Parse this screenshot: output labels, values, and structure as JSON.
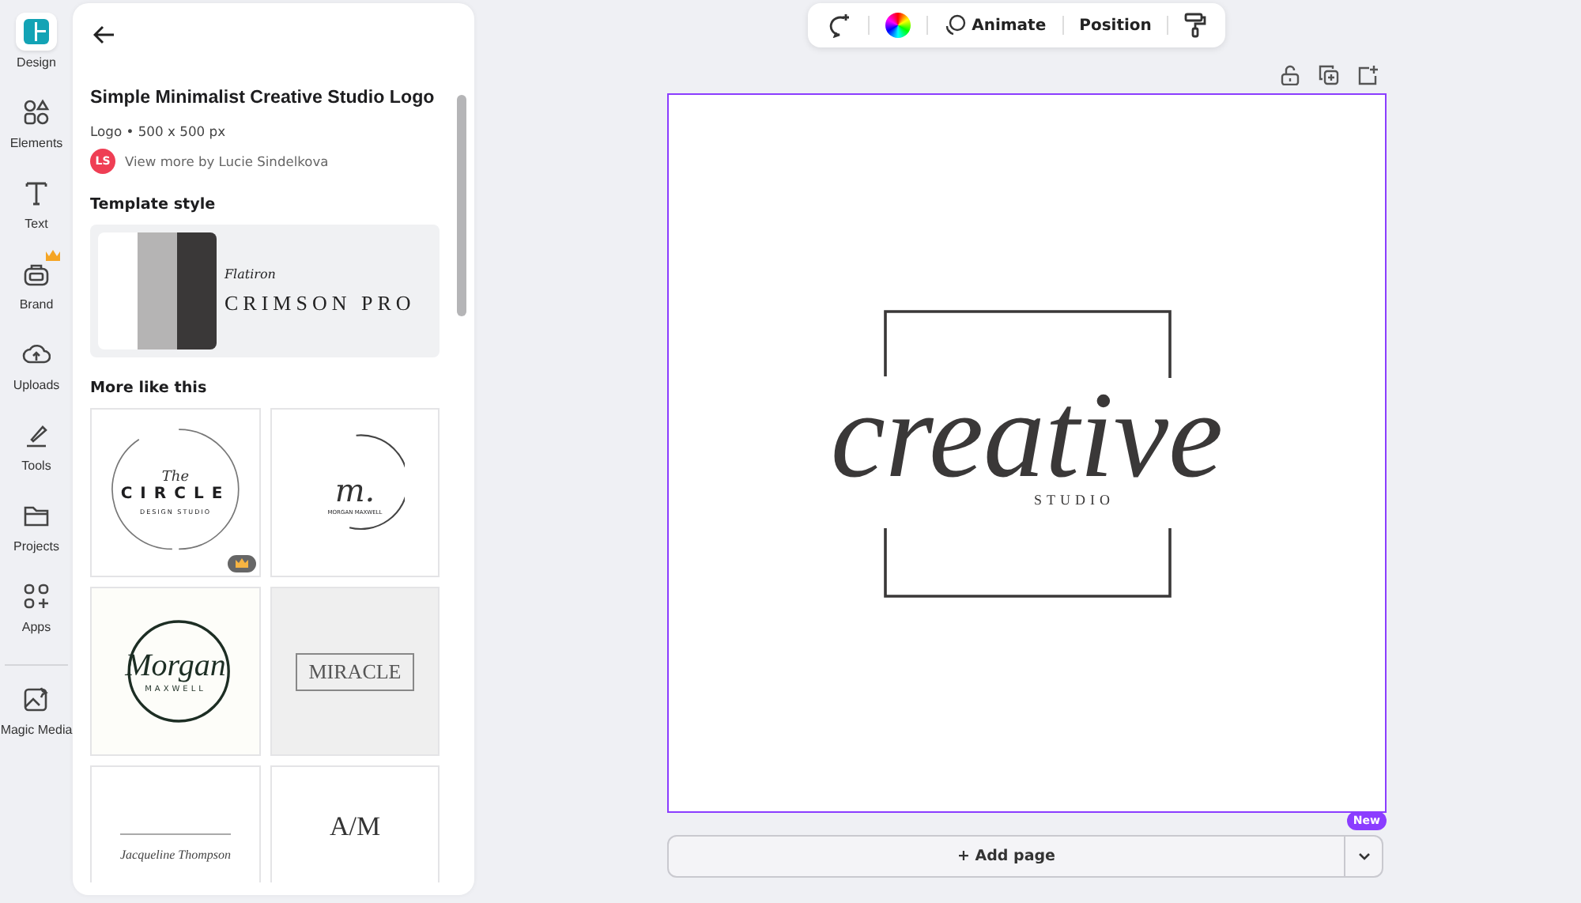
{
  "rail": {
    "items": [
      {
        "label": "Design",
        "kind": "design",
        "selected": true,
        "premium": false
      },
      {
        "label": "Elements",
        "kind": "elements",
        "selected": false,
        "premium": false
      },
      {
        "label": "Text",
        "kind": "text",
        "selected": false,
        "premium": false
      },
      {
        "label": "Brand",
        "kind": "brand",
        "selected": false,
        "premium": true
      },
      {
        "label": "Uploads",
        "kind": "uploads",
        "selected": false,
        "premium": false
      },
      {
        "label": "Tools",
        "kind": "tools",
        "selected": false,
        "premium": false
      },
      {
        "label": "Projects",
        "kind": "projects",
        "selected": false,
        "premium": false
      },
      {
        "label": "Apps",
        "kind": "apps",
        "selected": false,
        "premium": false
      },
      {
        "label": "Magic Media",
        "kind": "magic",
        "selected": false,
        "premium": false
      }
    ]
  },
  "panel": {
    "title": "Simple Minimalist Creative Studio Logo",
    "meta": "Logo • 500 x 500 px",
    "author": {
      "initials": "LS",
      "text": "View more by Lucie Sindelkova"
    },
    "style_heading": "Template style",
    "style": {
      "script_sample": "Flatiron",
      "font_name": "CRIMSON PRO",
      "swatches": [
        {
          "color": "#ffffff"
        },
        {
          "color": "#b5b4b4"
        },
        {
          "color": "#3a3838"
        }
      ]
    },
    "more_heading": "More like this",
    "templates": [
      {
        "kind": "circle",
        "texts": [
          "The",
          "CIRCLE",
          "DESIGN STUDIO"
        ],
        "premium": true
      },
      {
        "kind": "monogram",
        "texts": [
          "m.",
          "MORGAN MAXWELL"
        ],
        "premium": false
      },
      {
        "kind": "ring",
        "texts": [
          "Morgan",
          "MAXWELL"
        ],
        "premium": false
      },
      {
        "kind": "boxed",
        "texts": [
          "MIRACLE"
        ],
        "premium": false
      },
      {
        "kind": "signature",
        "texts": [
          "Jacqueline Thompson"
        ],
        "premium": false
      },
      {
        "kind": "initials",
        "texts": [
          "A/M"
        ],
        "premium": false
      }
    ]
  },
  "toolbar": {
    "items": [
      {
        "kind": "comment"
      },
      {
        "kind": "color"
      },
      {
        "kind": "animate",
        "label": "Animate"
      },
      {
        "kind": "text",
        "label": "Position"
      },
      {
        "kind": "paint"
      }
    ]
  },
  "canvas": {
    "selected": true,
    "logo": {
      "script": "creative",
      "sub": "STUDIO"
    }
  },
  "add_page": {
    "label": "+ Add page",
    "badge": "New"
  }
}
